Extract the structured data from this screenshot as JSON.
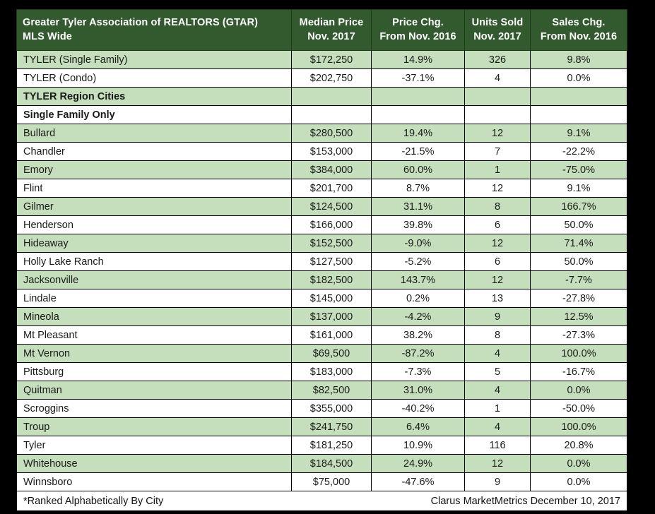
{
  "table": {
    "columns": [
      {
        "key": "city",
        "header_line1": "Greater Tyler Association of REALTORS (GTAR)",
        "header_line2": "MLS Wide"
      },
      {
        "key": "price",
        "header_line1": "Median Price",
        "header_line2": "Nov. 2017"
      },
      {
        "key": "pchg",
        "header_line1": "Price Chg.",
        "header_line2": "From Nov. 2016"
      },
      {
        "key": "units",
        "header_line1": "Units Sold",
        "header_line2": "Nov. 2017"
      },
      {
        "key": "schg",
        "header_line1": "Sales Chg.",
        "header_line2": "From Nov. 2016"
      }
    ],
    "rows": [
      {
        "city": "TYLER (Single Family)",
        "price": "$172,250",
        "pchg": "14.9%",
        "units": "326",
        "schg": "9.8%",
        "shaded": true,
        "section": false
      },
      {
        "city": "TYLER (Condo)",
        "price": "$202,750",
        "pchg": "-37.1%",
        "units": "4",
        "schg": "0.0%",
        "shaded": false,
        "section": false
      },
      {
        "city": "TYLER Region Cities",
        "price": "",
        "pchg": "",
        "units": "",
        "schg": "",
        "shaded": true,
        "section": true
      },
      {
        "city": "Single Family Only",
        "price": "",
        "pchg": "",
        "units": "",
        "schg": "",
        "shaded": false,
        "section": true
      },
      {
        "city": "Bullard",
        "price": "$280,500",
        "pchg": "19.4%",
        "units": "12",
        "schg": "9.1%",
        "shaded": true,
        "section": false
      },
      {
        "city": "Chandler",
        "price": "$153,000",
        "pchg": "-21.5%",
        "units": "7",
        "schg": "-22.2%",
        "shaded": false,
        "section": false
      },
      {
        "city": "Emory",
        "price": "$384,000",
        "pchg": "60.0%",
        "units": "1",
        "schg": "-75.0%",
        "shaded": true,
        "section": false
      },
      {
        "city": "Flint",
        "price": "$201,700",
        "pchg": "8.7%",
        "units": "12",
        "schg": "9.1%",
        "shaded": false,
        "section": false
      },
      {
        "city": "Gilmer",
        "price": "$124,500",
        "pchg": "31.1%",
        "units": "8",
        "schg": "166.7%",
        "shaded": true,
        "section": false
      },
      {
        "city": "Henderson",
        "price": "$166,000",
        "pchg": "39.8%",
        "units": "6",
        "schg": "50.0%",
        "shaded": false,
        "section": false
      },
      {
        "city": "Hideaway",
        "price": "$152,500",
        "pchg": "-9.0%",
        "units": "12",
        "schg": "71.4%",
        "shaded": true,
        "section": false
      },
      {
        "city": "Holly Lake Ranch",
        "price": "$127,500",
        "pchg": "-5.2%",
        "units": "6",
        "schg": "50.0%",
        "shaded": false,
        "section": false
      },
      {
        "city": "Jacksonville",
        "price": "$182,500",
        "pchg": "143.7%",
        "units": "12",
        "schg": "-7.7%",
        "shaded": true,
        "section": false
      },
      {
        "city": "Lindale",
        "price": "$145,000",
        "pchg": "0.2%",
        "units": "13",
        "schg": "-27.8%",
        "shaded": false,
        "section": false
      },
      {
        "city": "Mineola",
        "price": "$137,000",
        "pchg": "-4.2%",
        "units": "9",
        "schg": "12.5%",
        "shaded": true,
        "section": false
      },
      {
        "city": "Mt Pleasant",
        "price": "$161,000",
        "pchg": "38.2%",
        "units": "8",
        "schg": "-27.3%",
        "shaded": false,
        "section": false
      },
      {
        "city": "Mt Vernon",
        "price": "$69,500",
        "pchg": "-87.2%",
        "units": "4",
        "schg": "100.0%",
        "shaded": true,
        "section": false
      },
      {
        "city": "Pittsburg",
        "price": "$183,000",
        "pchg": "-7.3%",
        "units": "5",
        "schg": "-16.7%",
        "shaded": false,
        "section": false
      },
      {
        "city": "Quitman",
        "price": "$82,500",
        "pchg": "31.0%",
        "units": "4",
        "schg": "0.0%",
        "shaded": true,
        "section": false
      },
      {
        "city": "Scroggins",
        "price": "$355,000",
        "pchg": "-40.2%",
        "units": "1",
        "schg": "-50.0%",
        "shaded": false,
        "section": false
      },
      {
        "city": "Troup",
        "price": "$241,750",
        "pchg": "6.4%",
        "units": "4",
        "schg": "100.0%",
        "shaded": true,
        "section": false
      },
      {
        "city": "Tyler",
        "price": "$181,250",
        "pchg": "10.9%",
        "units": "116",
        "schg": "20.8%",
        "shaded": false,
        "section": false
      },
      {
        "city": "Whitehouse",
        "price": "$184,500",
        "pchg": "24.9%",
        "units": "12",
        "schg": "0.0%",
        "shaded": true,
        "section": false
      },
      {
        "city": "Winnsboro",
        "price": "$75,000",
        "pchg": "-47.6%",
        "units": "9",
        "schg": "0.0%",
        "shaded": false,
        "section": false
      }
    ],
    "footer": {
      "left": "*Ranked Alphabetically By City",
      "right": "Clarus MarketMetrics December 10, 2017"
    }
  },
  "colors": {
    "header_green": "#33592e",
    "row_green": "#c5debb",
    "row_white": "#ffffff",
    "border": "#000000",
    "page_background": "#000000"
  }
}
